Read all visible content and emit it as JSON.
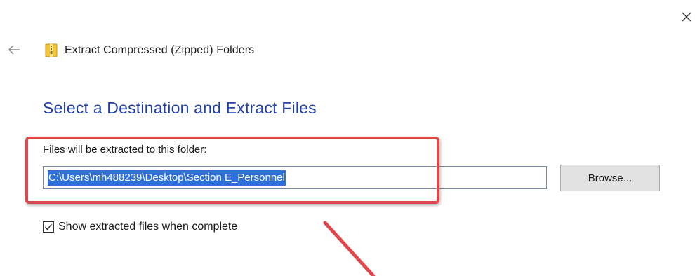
{
  "window": {
    "title": "Extract Compressed (Zipped) Folders",
    "close_icon": "close-icon",
    "back_icon": "arrow-left-icon",
    "app_icon": "zip-folder-icon"
  },
  "main": {
    "heading": "Select a Destination and Extract Files",
    "folder_label": "Files will be extracted to this folder:",
    "path_value": "C:\\Users\\mh488239\\Desktop\\Section E_Personnel",
    "browse_label": "Browse...",
    "checkbox": {
      "label": "Show extracted files when complete",
      "checked": true
    }
  },
  "annotation": {
    "highlight_color": "#e0474d"
  },
  "colors": {
    "heading": "#1f3fa6",
    "selection": "#2f6fd8",
    "button_bg": "#e1e1e1"
  }
}
